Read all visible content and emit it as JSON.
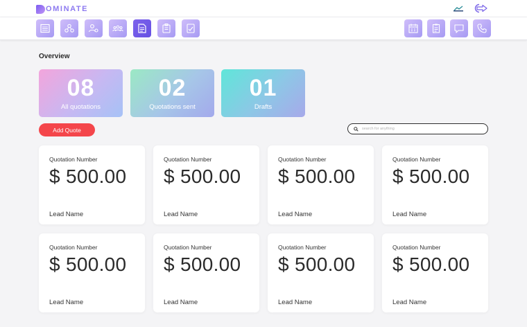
{
  "app": {
    "logo_text": "OMINATE",
    "brand_color": "#8d7af0"
  },
  "toolbar": {
    "left_tools": [
      {
        "icon": "list-icon"
      },
      {
        "icon": "network-icon"
      },
      {
        "icon": "user-gear-icon"
      },
      {
        "icon": "team-icon"
      },
      {
        "icon": "quotation-icon",
        "active": true
      },
      {
        "icon": "clipboard-icon"
      },
      {
        "icon": "checklist-icon"
      }
    ],
    "right_tools": [
      {
        "icon": "calendar-icon"
      },
      {
        "icon": "notes-icon"
      },
      {
        "icon": "chat-icon"
      },
      {
        "icon": "phone-icon"
      }
    ]
  },
  "overview": {
    "title": "Overview",
    "stats": [
      {
        "value": "08",
        "label": "All quotations"
      },
      {
        "value": "02",
        "label": "Quotations sent"
      },
      {
        "value": "01",
        "label": "Drafts"
      }
    ]
  },
  "actions": {
    "add_label": "Add Quote",
    "add_color": "#f4464b"
  },
  "search": {
    "placeholder": "search for anything"
  },
  "quotes": [
    {
      "number_label": "Quotation Number",
      "amount": "$ 500.00",
      "lead": "Lead Name"
    },
    {
      "number_label": "Quotation Number",
      "amount": "$ 500.00",
      "lead": "Lead Name"
    },
    {
      "number_label": "Quotation Number",
      "amount": "$ 500.00",
      "lead": "Lead Name"
    },
    {
      "number_label": "Quotation Number",
      "amount": "$ 500.00",
      "lead": "Lead Name"
    },
    {
      "number_label": "Quotation Number",
      "amount": "$ 500.00",
      "lead": "Lead Name"
    },
    {
      "number_label": "Quotation Number",
      "amount": "$ 500.00",
      "lead": "Lead Name"
    },
    {
      "number_label": "Quotation Number",
      "amount": "$ 500.00",
      "lead": "Lead Name"
    },
    {
      "number_label": "Quotation Number",
      "amount": "$ 500.00",
      "lead": "Lead Name"
    }
  ]
}
